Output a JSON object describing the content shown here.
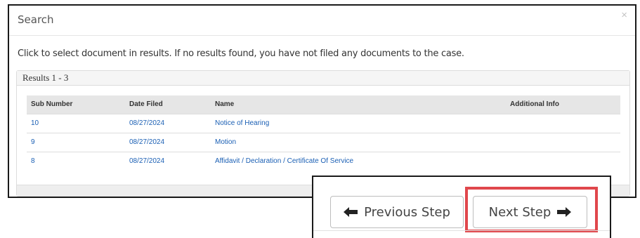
{
  "modal": {
    "title": "Search",
    "close_glyph": "×",
    "instruction": "Click to select document in results. If no results found, you have not filed any documents to the case."
  },
  "results": {
    "heading": "Results 1 - 3",
    "columns": [
      "Sub Number",
      "Date Filed",
      "Name",
      "Additional Info"
    ],
    "rows": [
      {
        "sub_number": "10",
        "date_filed": "08/27/2024",
        "name": "Notice of Hearing",
        "additional_info": ""
      },
      {
        "sub_number": "9",
        "date_filed": "08/27/2024",
        "name": "Motion",
        "additional_info": ""
      },
      {
        "sub_number": "8",
        "date_filed": "08/27/2024",
        "name": "Affidavit / Declaration / Certificate Of Service",
        "additional_info": ""
      }
    ]
  },
  "navigation": {
    "previous_label": "Previous Step",
    "next_label": "Next Step",
    "previous_icon": "arrow-left-icon",
    "next_icon": "arrow-right-icon",
    "highlight_color": "#e0474c"
  },
  "colors": {
    "link": "#1a5fb4",
    "table_header_bg": "#e6e6e6"
  }
}
